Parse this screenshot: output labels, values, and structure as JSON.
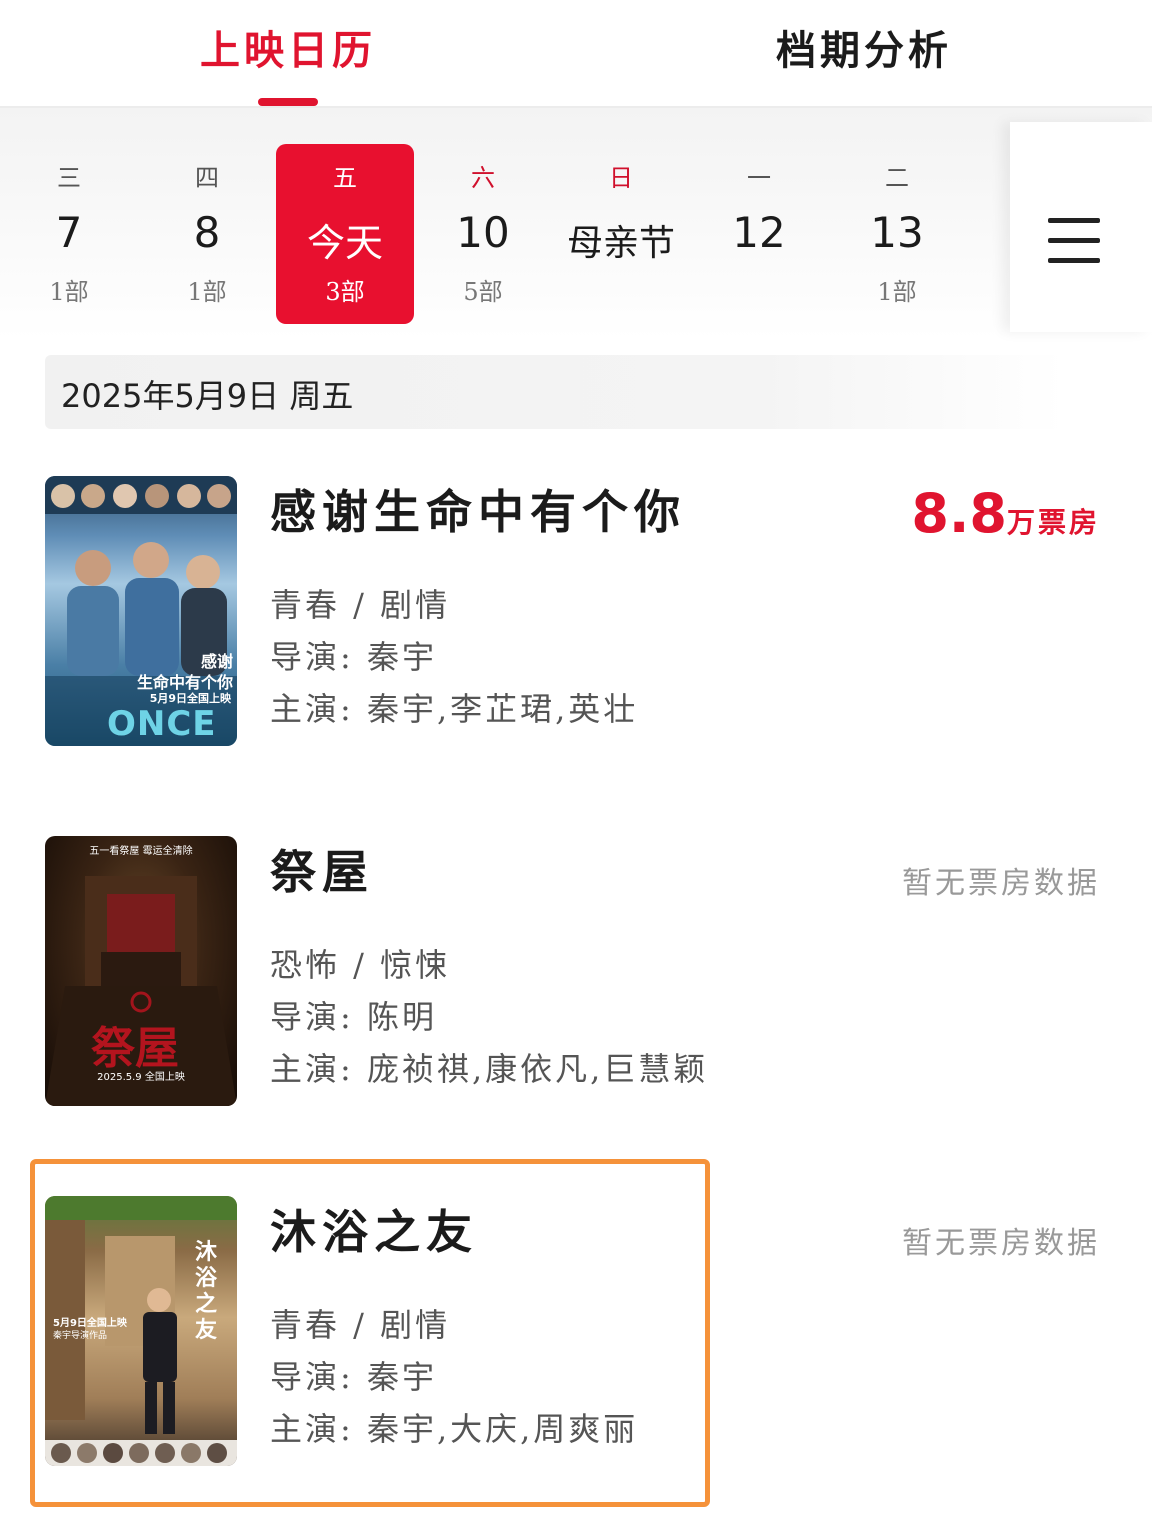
{
  "tabs": {
    "calendar": "上映日历",
    "analysis": "档期分析"
  },
  "calendar": {
    "days": [
      {
        "weekday": "三",
        "label": "7",
        "count": "1部",
        "weekend": false,
        "selected": false
      },
      {
        "weekday": "四",
        "label": "8",
        "count": "1部",
        "weekend": false,
        "selected": false
      },
      {
        "weekday": "五",
        "label": "今天",
        "count": "3部",
        "weekend": false,
        "selected": true
      },
      {
        "weekday": "六",
        "label": "10",
        "count": "5部",
        "weekend": true,
        "selected": false
      },
      {
        "weekday": "日",
        "label": "母亲节",
        "count": "",
        "weekend": true,
        "selected": false
      },
      {
        "weekday": "一",
        "label": "12",
        "count": "",
        "weekend": false,
        "selected": false
      },
      {
        "weekday": "二",
        "label": "13",
        "count": "1部",
        "weekend": false,
        "selected": false
      }
    ],
    "menu_icon": "hamburger-menu-icon"
  },
  "date_header": "2025年5月9日  周五",
  "movies": [
    {
      "title": "感谢生命中有个你",
      "genre": "青春 / 剧情",
      "director": "导演: 秦宇",
      "cast": "主演: 秦宇,李芷珺,英壮",
      "box_office_value": "8.8",
      "box_office_unit": "万票房",
      "poster_text": {
        "line1": "感谢",
        "line2": "生命中有个你",
        "line3": "5月9日全国上映",
        "line4": "ONCE"
      }
    },
    {
      "title": "祭屋",
      "genre": "恐怖 / 惊悚",
      "director": "导演: 陈明",
      "cast": "主演: 庞祯祺,康依凡,巨慧颖",
      "no_data": "暂无票房数据",
      "poster_text": {
        "top": "五一看祭屋 霉运全清除",
        "logo": "祭屋",
        "date": "2025.5.9 全国上映"
      }
    },
    {
      "title": "沐浴之友",
      "genre": "青春 / 剧情",
      "director": "导演: 秦宇",
      "cast": "主演: 秦宇,大庆,周爽丽",
      "no_data": "暂无票房数据",
      "poster_text": {
        "logo": "沐浴之友",
        "date": "5月9日全国上映",
        "credit": "秦宇导演作品"
      }
    }
  ],
  "colors": {
    "accent": "#e0142f",
    "highlight": "#f5923a"
  }
}
